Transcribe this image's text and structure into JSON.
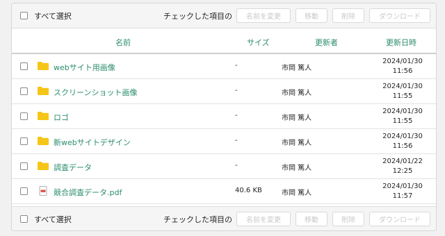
{
  "toolbar": {
    "select_all": "すべて選択",
    "checked_label": "チェックした項目の",
    "rename": "名前を変更",
    "move": "移動",
    "delete": "削除",
    "download": "ダウンロード"
  },
  "columns": {
    "name": "名前",
    "size": "サイズ",
    "updater": "更新者",
    "updated": "更新日時"
  },
  "rows": [
    {
      "type": "folder",
      "name": "webサイト用画像",
      "size": "-",
      "updater": "市岡 篤人",
      "date": "2024/01/30",
      "time": "11:56"
    },
    {
      "type": "folder",
      "name": "スクリーンショット画像",
      "size": "-",
      "updater": "市岡 篤人",
      "date": "2024/01/30",
      "time": "11:55"
    },
    {
      "type": "folder",
      "name": "ロゴ",
      "size": "-",
      "updater": "市岡 篤人",
      "date": "2024/01/30",
      "time": "11:55"
    },
    {
      "type": "folder",
      "name": "新webサイトデザイン",
      "size": "-",
      "updater": "市岡 篤人",
      "date": "2024/01/30",
      "time": "11:56"
    },
    {
      "type": "folder",
      "name": "調査データ",
      "size": "-",
      "updater": "市岡 篤人",
      "date": "2024/01/22",
      "time": "12:25"
    },
    {
      "type": "pdf",
      "name": "競合調査データ.pdf",
      "size": "40.6 KB",
      "updater": "市岡 篤人",
      "date": "2024/01/30",
      "time": "11:57"
    }
  ],
  "colors": {
    "accent": "#2a8c6e",
    "folder": "#f5c518",
    "pdf": "#d9534f"
  },
  "icons": {
    "folder": "folder-icon",
    "pdf": "pdf-file-icon"
  }
}
